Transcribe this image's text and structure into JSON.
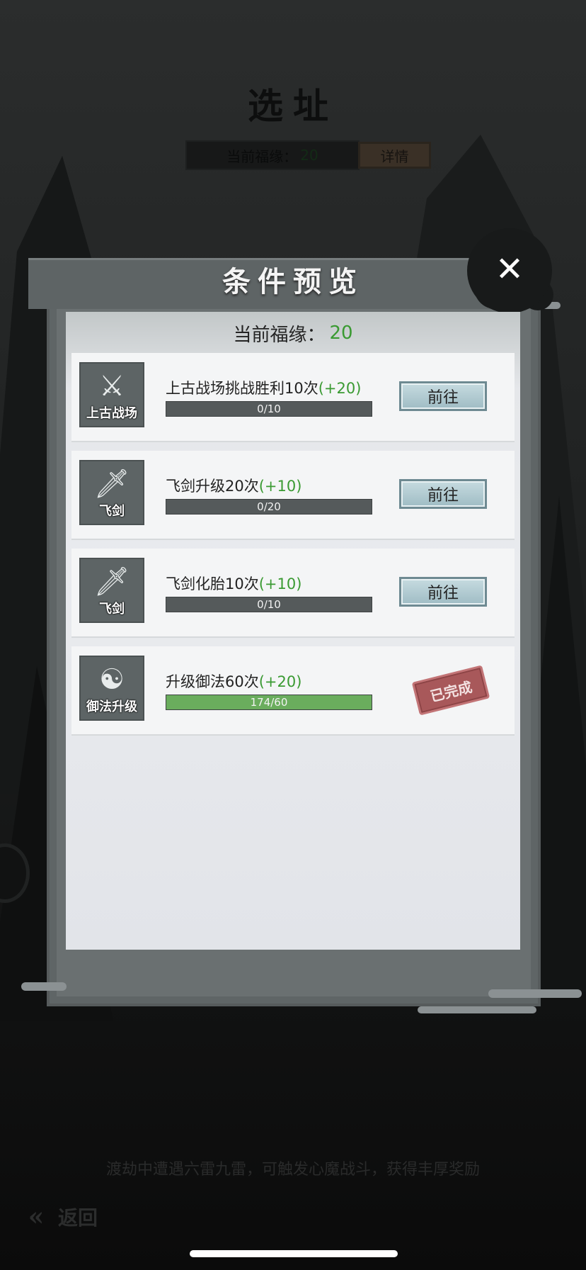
{
  "background": {
    "page_title": "选址",
    "fortune_label": "当前福缘：",
    "fortune_value": "20",
    "details_label": "详情",
    "hint_text": "渡劫中遭遇六雷九雷，可触发心魔战斗，获得丰厚奖励",
    "back_label": "返回"
  },
  "modal": {
    "title": "条件预览",
    "current_fortune_label": "当前福缘：",
    "current_fortune_value": "20",
    "go_label": "前往",
    "done_label": "已完成",
    "tasks": [
      {
        "icon": "crossed-swords-icon",
        "icon_label": "上古战场",
        "title": "上古战场挑战胜利10次",
        "reward": "(+20)",
        "progress_text": "0/10",
        "progress_fraction": 0,
        "status": "go"
      },
      {
        "icon": "flying-sword-icon",
        "icon_label": "飞剑",
        "title": "飞剑升级20次",
        "reward": "(+10)",
        "progress_text": "0/20",
        "progress_fraction": 0,
        "status": "go"
      },
      {
        "icon": "flying-sword-icon",
        "icon_label": "飞剑",
        "title": "飞剑化胎10次",
        "reward": "(+10)",
        "progress_text": "0/10",
        "progress_fraction": 0,
        "status": "go"
      },
      {
        "icon": "yin-yang-icon",
        "icon_label": "御法升级",
        "title": "升级御法60次",
        "reward": "(+20)",
        "progress_text": "174/60",
        "progress_fraction": 1,
        "status": "done"
      }
    ]
  },
  "colors": {
    "reward_green": "#3a9a32",
    "progress_fill": "#6aad5d",
    "done_stamp": "#a8585a"
  }
}
